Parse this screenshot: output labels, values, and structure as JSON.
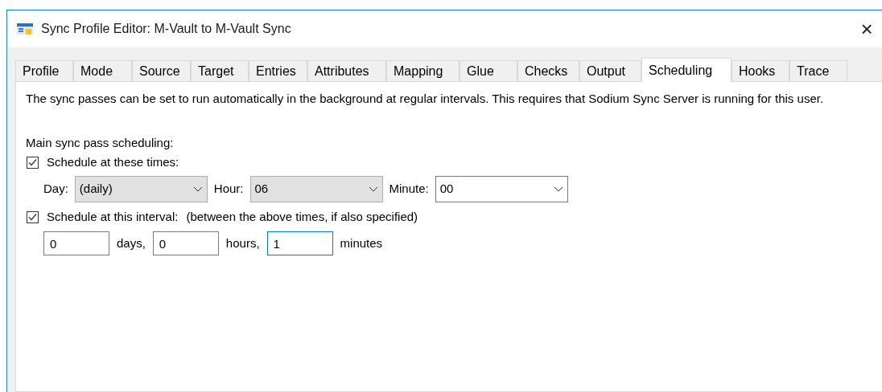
{
  "window": {
    "title": "Sync Profile Editor: M-Vault to M-Vault Sync",
    "close": "×"
  },
  "tabs": [
    {
      "label": "Profile",
      "selected": false
    },
    {
      "label": "Mode",
      "selected": false
    },
    {
      "label": "Source",
      "selected": false
    },
    {
      "label": "Target",
      "selected": false
    },
    {
      "label": "Entries",
      "selected": false
    },
    {
      "label": "Attributes",
      "selected": false
    },
    {
      "label": "Mapping",
      "selected": false
    },
    {
      "label": "Glue",
      "selected": false
    },
    {
      "label": "Checks",
      "selected": false
    },
    {
      "label": "Output",
      "selected": false
    },
    {
      "label": "Scheduling",
      "selected": true
    },
    {
      "label": "Hooks",
      "selected": false
    },
    {
      "label": "Trace",
      "selected": false
    }
  ],
  "description": "The sync passes can be set to run automatically in the background at regular intervals.  This requires that Sodium Sync Server is running for this user.",
  "section_label": "Main sync pass scheduling:",
  "times": {
    "label": "Schedule at these times:",
    "checked": true,
    "dropdowns": [
      {
        "label": "Day:",
        "value": "(daily)",
        "disabled": true
      },
      {
        "label": "Hour:",
        "value": "06",
        "disabled": true
      },
      {
        "label": "Minute:",
        "value": "00",
        "disabled": false
      }
    ]
  },
  "interval": {
    "label": "Schedule at this interval:",
    "note": "(between the above times, if also specified)",
    "checked": true,
    "fields": [
      {
        "value": "0",
        "unit": "days,",
        "focused": false
      },
      {
        "value": "0",
        "unit": "hours,",
        "focused": false
      },
      {
        "value": "1",
        "unit": "minutes",
        "focused": true
      }
    ]
  }
}
